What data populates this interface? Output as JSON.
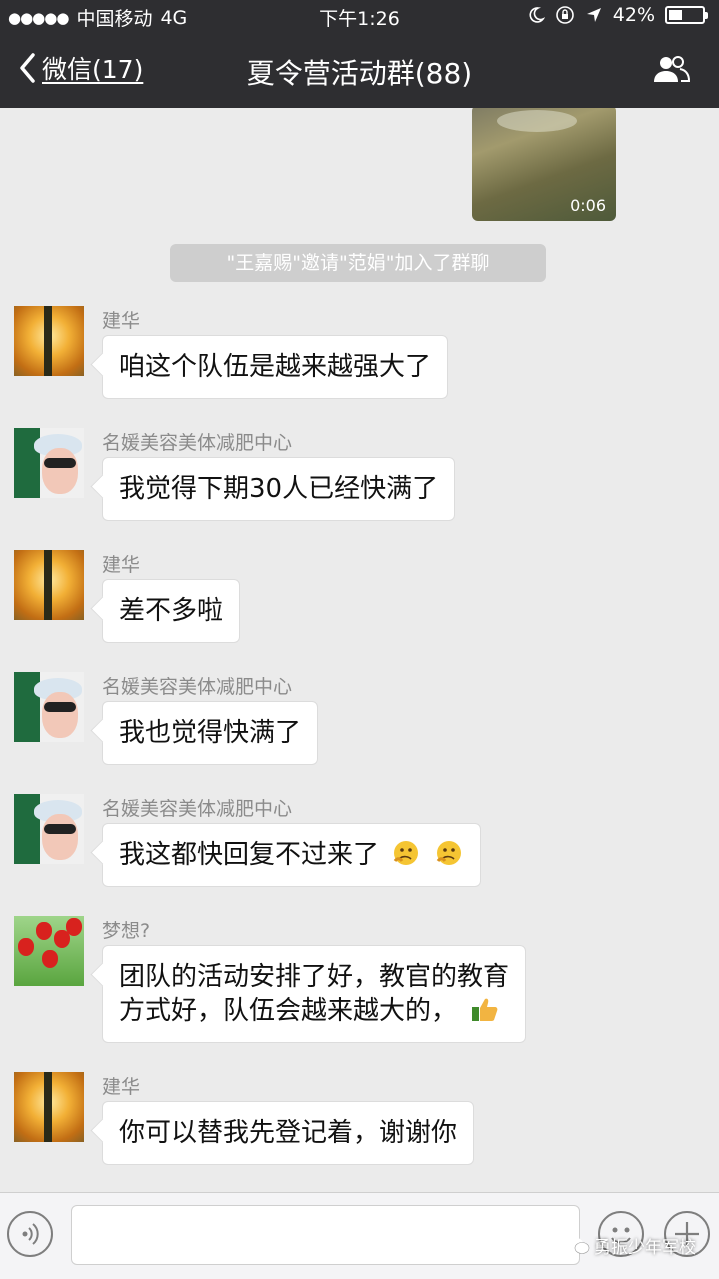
{
  "status_bar": {
    "signal": "●●●●●",
    "carrier": "中国移动",
    "network": "4G",
    "time": "下午1:26",
    "battery": "42%",
    "battery_level": 0.42
  },
  "nav": {
    "back_label": "微信(17)",
    "title": "夏令营活动群(88)",
    "right_icon": "group-members-icon"
  },
  "video": {
    "duration": "0:06"
  },
  "system_notice": "\"王嘉赐\"邀请\"范娟\"加入了群聊",
  "messages": [
    {
      "sender": "建华",
      "text": "咱这个队伍是越来越强大了"
    },
    {
      "sender": "名媛美容美体减肥中心",
      "text": "我觉得下期30人已经快满了"
    },
    {
      "sender": "建华",
      "text": "差不多啦"
    },
    {
      "sender": "名媛美容美体减肥中心",
      "text": "我也觉得快满了"
    },
    {
      "sender": "名媛美容美体减肥中心",
      "text": "我这都快回复不过来了"
    },
    {
      "sender": "梦想?",
      "text_line1": "团队的活动安排了好，教官的教育",
      "text_line2": "方式好，队伍会越来越大的，"
    },
    {
      "sender": "建华",
      "text": "你可以替我先登记着，谢谢你"
    }
  ],
  "input_bar": {
    "watermark": "勇振少年军校"
  },
  "icons": [
    "back-chevron-icon",
    "moon-icon",
    "lock-rotation-icon",
    "location-arrow-icon",
    "group-members-icon",
    "voice-icon",
    "smiley-icon",
    "plus-icon",
    "thinking-emoji-icon",
    "thumbs-up-emoji-icon",
    "wechat-logo-icon"
  ]
}
